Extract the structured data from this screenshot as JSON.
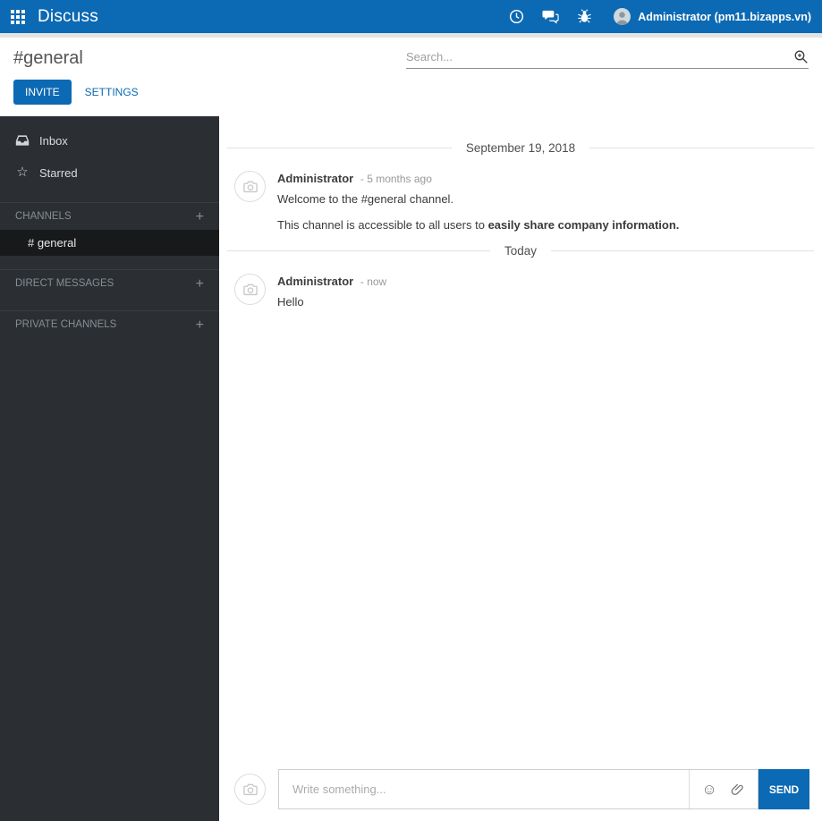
{
  "colors": {
    "accent": "#0c69b3",
    "navbar_bg": "#0c69b3",
    "sidebar_bg": "#2b2f33",
    "sidebar_active_bg": "#17191b"
  },
  "navbar": {
    "app_title": "Discuss",
    "user_name": "Administrator (pm11.bizapps.vn)"
  },
  "control_panel": {
    "title": "#general",
    "search_placeholder": "Search...",
    "invite_label": "INVITE",
    "settings_label": "SETTINGS"
  },
  "sidebar": {
    "mailboxes": [
      {
        "label": "Inbox"
      },
      {
        "label": "Starred"
      }
    ],
    "sections": [
      {
        "label": "CHANNELS"
      },
      {
        "label": "DIRECT MESSAGES"
      },
      {
        "label": "PRIVATE CHANNELS"
      }
    ],
    "active_channel": "# general"
  },
  "thread": {
    "separator_first": "September 19, 2018",
    "separator_second": "Today",
    "messages": {
      "welcome": {
        "author": "Administrator",
        "timestamp": "- 5 months ago",
        "line1": "Welcome to the #general channel.",
        "line2_prefix": "This channel is accessible to all users to ",
        "line2_bold": "easily share company information."
      },
      "hello": {
        "author": "Administrator",
        "timestamp": "- now",
        "text": "Hello"
      }
    }
  },
  "composer": {
    "placeholder": "Write something...",
    "send_label": "SEND"
  },
  "icons": {
    "star": "☆",
    "plus": "+",
    "smiley": "☺"
  }
}
